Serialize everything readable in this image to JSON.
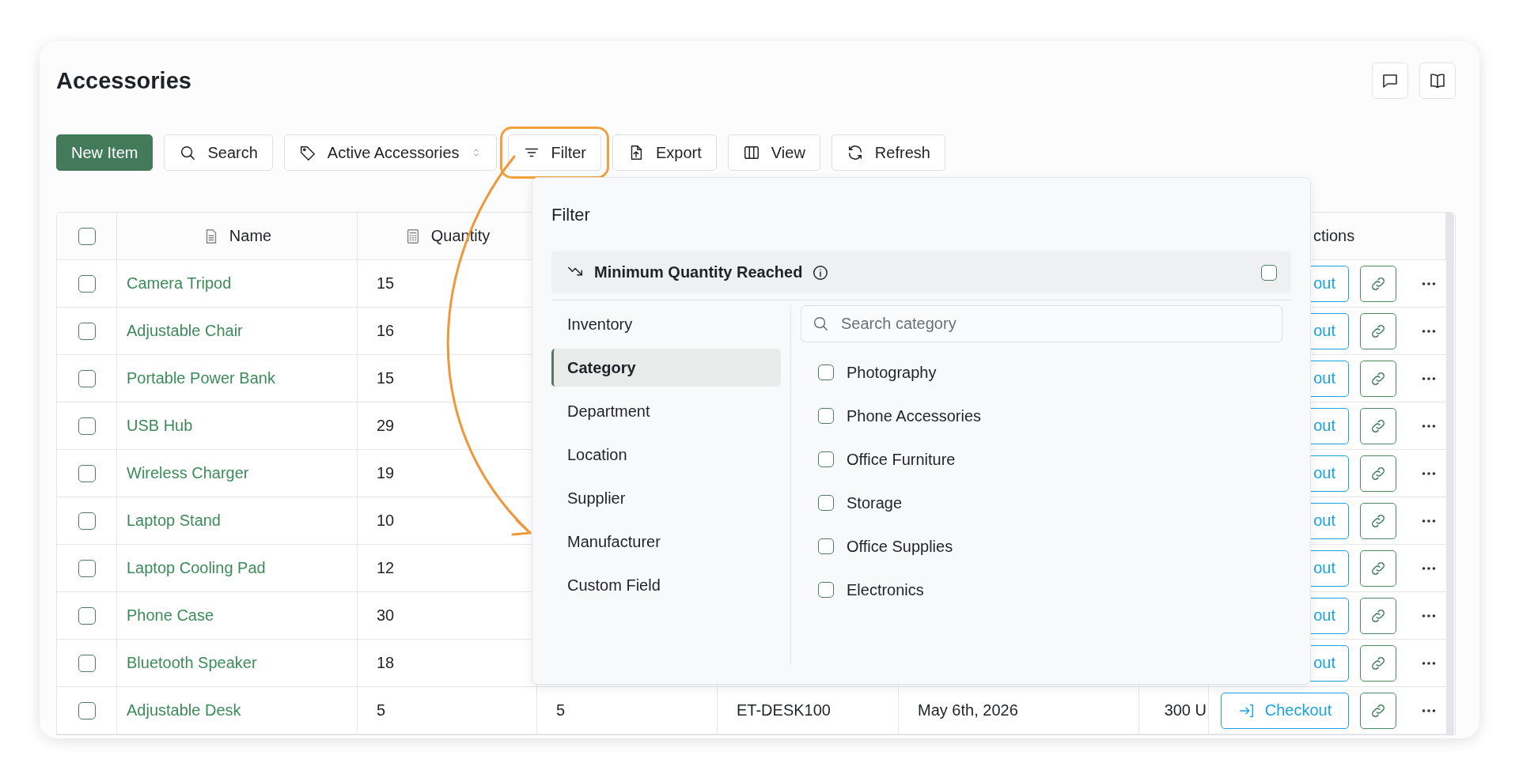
{
  "page": {
    "title": "Accessories"
  },
  "header_actions": [
    {
      "kind": "comment"
    },
    {
      "kind": "book"
    }
  ],
  "toolbar": [
    {
      "kind": "primary",
      "label": "New Item",
      "highlighted": false
    },
    {
      "kind": "search",
      "label": "Search",
      "highlighted": false
    },
    {
      "kind": "dropdown",
      "label": "Active Accessories",
      "highlighted": false
    },
    {
      "kind": "filter",
      "label": "Filter",
      "highlighted": true
    },
    {
      "kind": "export",
      "label": "Export",
      "highlighted": false
    },
    {
      "kind": "view",
      "label": "View",
      "highlighted": false
    },
    {
      "kind": "refresh",
      "label": "Refresh",
      "highlighted": false
    }
  ],
  "table": {
    "columns": [
      {
        "kind": "checkbox",
        "checked": false
      },
      {
        "kind": "name",
        "label": "Name"
      },
      {
        "kind": "quantity",
        "label": "Quantity"
      },
      {
        "kind": "blank"
      },
      {
        "kind": "blank"
      },
      {
        "kind": "blank"
      },
      {
        "kind": "blank"
      },
      {
        "kind": "actions",
        "label": "ctions"
      }
    ],
    "rows": [
      {
        "checked": false,
        "name": "Camera Tripod",
        "quantity": "15",
        "checkout": "out"
      },
      {
        "checked": false,
        "name": "Adjustable Chair",
        "quantity": "16",
        "checkout": "out"
      },
      {
        "checked": false,
        "name": "Portable Power Bank",
        "quantity": "15",
        "checkout": "out"
      },
      {
        "checked": false,
        "name": "USB Hub",
        "quantity": "29",
        "checkout": "out"
      },
      {
        "checked": false,
        "name": "Wireless Charger",
        "quantity": "19",
        "checkout": "out"
      },
      {
        "checked": false,
        "name": "Laptop Stand",
        "quantity": "10",
        "checkout": "out"
      },
      {
        "checked": false,
        "name": "Laptop Cooling Pad",
        "quantity": "12",
        "checkout": "out"
      },
      {
        "checked": false,
        "name": "Phone Case",
        "quantity": "30",
        "checkout": "out"
      },
      {
        "checked": false,
        "name": "Bluetooth Speaker",
        "quantity": "18",
        "checkout": "out"
      },
      {
        "checked": false,
        "name": "Adjustable Desk",
        "quantity": "5",
        "column_4": "5",
        "column_5": "ET-DESK100",
        "column_6": "May 6th, 2026",
        "column_7": "300 U",
        "checkout": "Checkout"
      }
    ]
  },
  "filter_panel": {
    "title": "Filter",
    "minimum_quantity": {
      "label": "Minimum Quantity Reached",
      "checked": false
    },
    "groups": [
      {
        "label": "Inventory",
        "selected": false
      },
      {
        "label": "Category",
        "selected": true
      },
      {
        "label": "Department",
        "selected": false
      },
      {
        "label": "Location",
        "selected": false
      },
      {
        "label": "Supplier",
        "selected": false
      },
      {
        "label": "Manufacturer",
        "selected": false
      },
      {
        "label": "Custom Field",
        "selected": false
      }
    ],
    "search": {
      "placeholder": "Search category"
    },
    "options": [
      {
        "label": "Photography",
        "checked": false
      },
      {
        "label": "Phone Accessories",
        "checked": false
      },
      {
        "label": "Office Furniture",
        "checked": false
      },
      {
        "label": "Storage",
        "checked": false
      },
      {
        "label": "Office Supplies",
        "checked": false
      },
      {
        "label": "Electronics",
        "checked": false
      }
    ]
  },
  "annotation": {
    "arrow": true
  }
}
